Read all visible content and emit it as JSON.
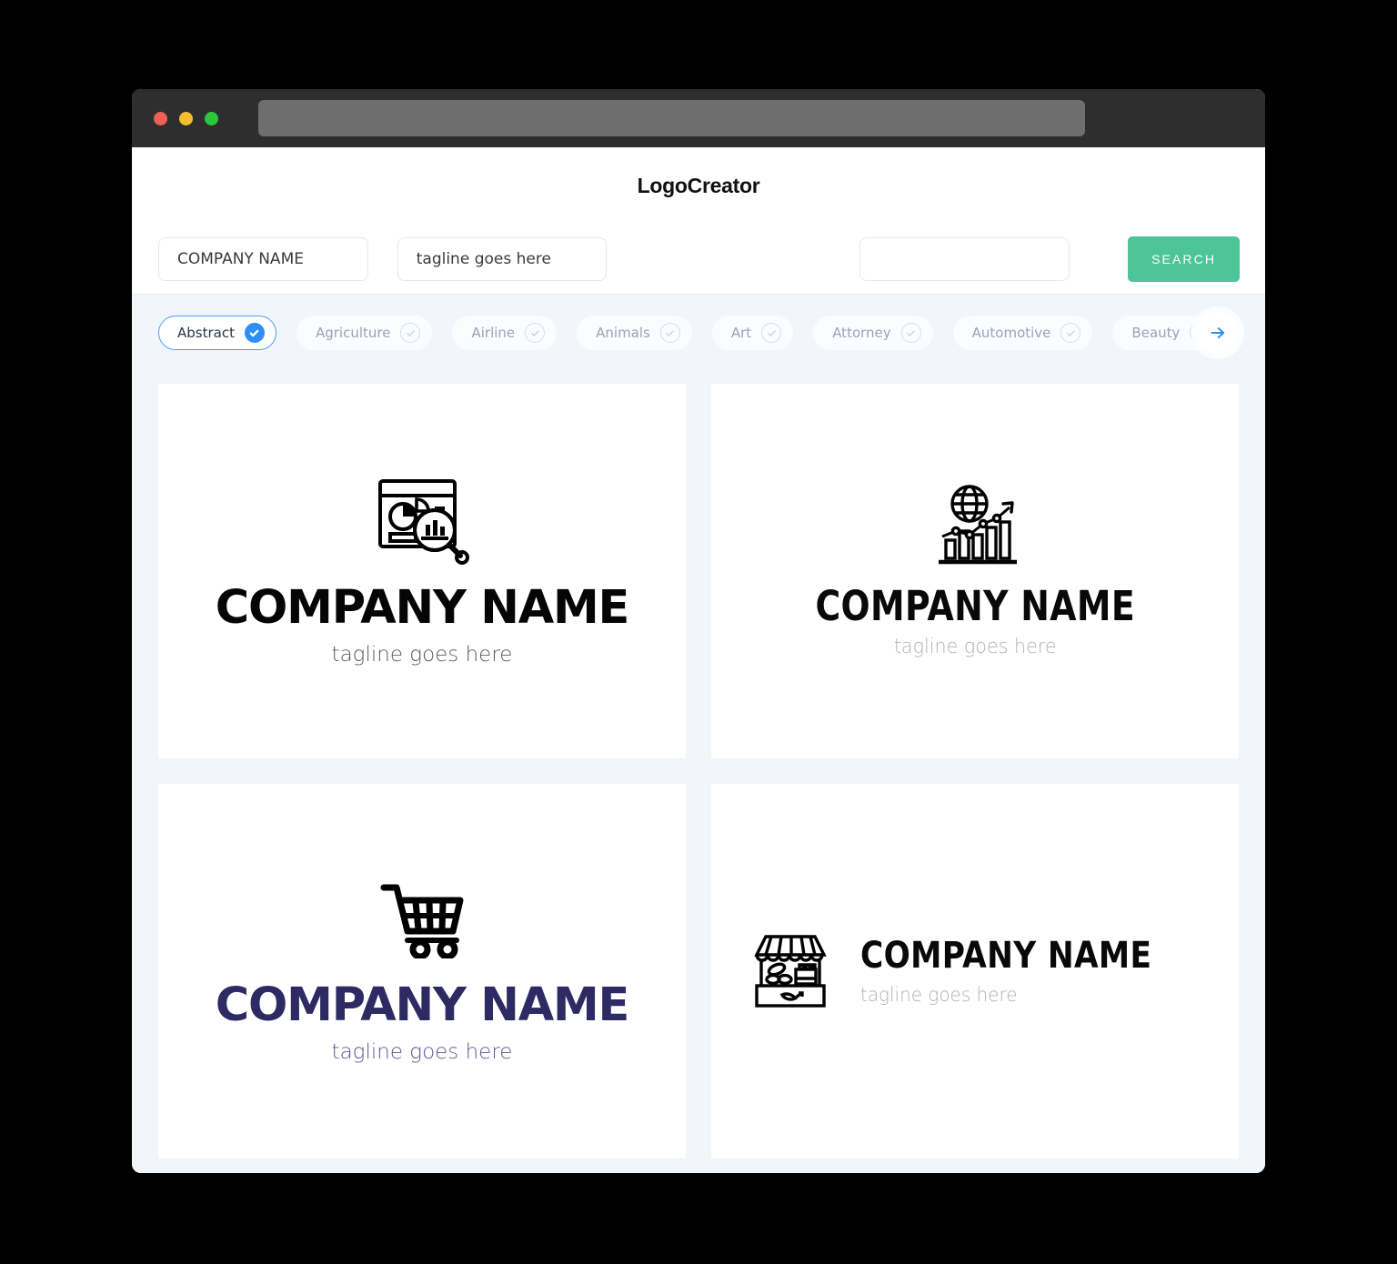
{
  "window": {
    "traffic_lights": [
      {
        "name": "close",
        "color": "#ee5f56"
      },
      {
        "name": "minimize",
        "color": "#f5bd2e"
      },
      {
        "name": "maximize",
        "color": "#2ac83f"
      }
    ],
    "url_value": ""
  },
  "header": {
    "app_title": "LogoCreator"
  },
  "toolbar": {
    "company_value": "COMPANY NAME",
    "company_placeholder": "COMPANY NAME",
    "tagline_value": "tagline goes here",
    "tagline_placeholder": "tagline goes here",
    "keyword_value": "",
    "keyword_placeholder": "",
    "search_label": "SEARCH",
    "search_color": "#4ec49a"
  },
  "categories": {
    "accent_color": "#2f8ef4",
    "next_icon": "arrow-right-icon",
    "items": [
      {
        "label": "Abstract",
        "selected": true
      },
      {
        "label": "Agriculture",
        "selected": false
      },
      {
        "label": "Airline",
        "selected": false
      },
      {
        "label": "Animals",
        "selected": false
      },
      {
        "label": "Art",
        "selected": false
      },
      {
        "label": "Attorney",
        "selected": false
      },
      {
        "label": "Automotive",
        "selected": false
      },
      {
        "label": "Beauty",
        "selected": false
      }
    ]
  },
  "logos": [
    {
      "icon": "analytics-dashboard-magnifier-icon",
      "name": "COMPANY NAME",
      "tagline": "tagline goes here",
      "name_color": "#050505",
      "tagline_color": "#5c5c5c",
      "layout": "stacked"
    },
    {
      "icon": "globe-growth-chart-icon",
      "name": "COMPANY NAME",
      "tagline": "tagline goes here",
      "name_color": "#090909",
      "tagline_color": "#b2b2b2",
      "layout": "stacked"
    },
    {
      "icon": "shopping-cart-icon",
      "name": "COMPANY NAME",
      "tagline": "tagline goes here",
      "name_color": "#2e2a63",
      "tagline_color": "#5e5b93",
      "layout": "stacked"
    },
    {
      "icon": "market-stall-storefront-icon",
      "name": "COMPANY NAME",
      "tagline": "tagline goes here",
      "name_color": "#090909",
      "tagline_color": "#b2b2b2",
      "layout": "horizontal"
    }
  ]
}
